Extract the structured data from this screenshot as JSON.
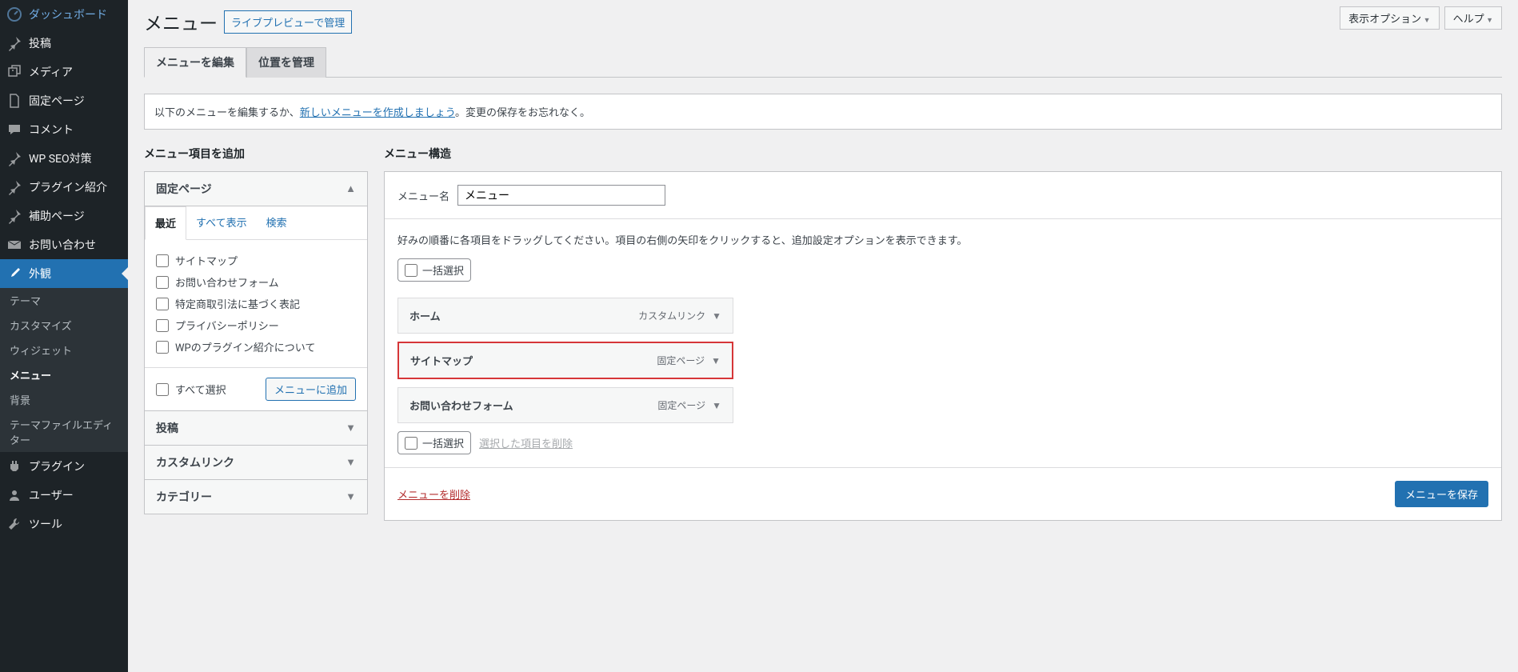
{
  "sidebar": {
    "items": [
      {
        "label": "ダッシュボード",
        "icon": "dashboard"
      },
      {
        "label": "投稿",
        "icon": "pin"
      },
      {
        "label": "メディア",
        "icon": "media"
      },
      {
        "label": "固定ページ",
        "icon": "page"
      },
      {
        "label": "コメント",
        "icon": "comment"
      },
      {
        "label": "WP SEO対策",
        "icon": "pin"
      },
      {
        "label": "プラグイン紹介",
        "icon": "pin"
      },
      {
        "label": "補助ページ",
        "icon": "pin"
      },
      {
        "label": "お問い合わせ",
        "icon": "mail"
      },
      {
        "label": "外観",
        "icon": "brush",
        "active": true
      },
      {
        "label": "プラグイン",
        "icon": "plugin"
      },
      {
        "label": "ユーザー",
        "icon": "user"
      },
      {
        "label": "ツール",
        "icon": "tools"
      }
    ],
    "sub": [
      "テーマ",
      "カスタマイズ",
      "ウィジェット",
      "メニュー",
      "背景",
      "テーマファイルエディター"
    ],
    "sub_active": "メニュー"
  },
  "top": {
    "screen_options": "表示オプション",
    "help": "ヘルプ"
  },
  "header": {
    "title": "メニュー",
    "live_preview": "ライブプレビューで管理"
  },
  "tabs": {
    "edit": "メニューを編集",
    "locations": "位置を管理"
  },
  "notice": {
    "prefix": "以下のメニューを編集するか、",
    "link": "新しいメニューを作成しましょう",
    "suffix": "。変更の保存をお忘れなく。"
  },
  "left": {
    "title": "メニュー項目を追加",
    "panel_pages": "固定ページ",
    "inner_tabs": {
      "recent": "最近",
      "view_all": "すべて表示",
      "search": "検索"
    },
    "pages": [
      "サイトマップ",
      "お問い合わせフォーム",
      "特定商取引法に基づく表記",
      "プライバシーポリシー",
      "WPのプラグイン紹介について"
    ],
    "select_all": "すべて選択",
    "add_to_menu": "メニューに追加",
    "panel_posts": "投稿",
    "panel_custom": "カスタムリンク",
    "panel_categories": "カテゴリー"
  },
  "right": {
    "title": "メニュー構造",
    "name_label": "メニュー名",
    "name_value": "メニュー",
    "hint": "好みの順番に各項目をドラッグしてください。項目の右側の矢印をクリックすると、追加設定オプションを表示できます。",
    "bulk_select": "一括選択",
    "items": [
      {
        "title": "ホーム",
        "type": "カスタムリンク",
        "highlighted": false
      },
      {
        "title": "サイトマップ",
        "type": "固定ページ",
        "highlighted": true
      },
      {
        "title": "お問い合わせフォーム",
        "type": "固定ページ",
        "highlighted": false
      }
    ],
    "remove_selected": "選択した項目を削除",
    "delete_menu": "メニューを削除",
    "save_menu": "メニューを保存"
  }
}
